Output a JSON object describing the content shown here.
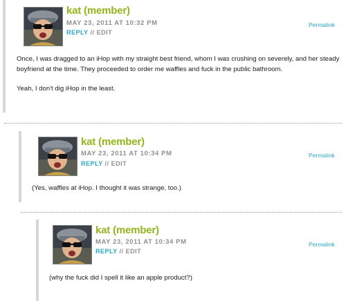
{
  "comments": [
    {
      "author": "kat (member)",
      "date": "MAY 23, 2011 AT 10:32 PM",
      "reply_label": "REPLY",
      "separator": "//",
      "edit_label": "EDIT",
      "permalink": "Permalink",
      "paragraphs": [
        "Once, I was dragged to an iHop with my straight best friend, whom I was crushing on severely, and her steady boyfriend at the time. They proceeded to order me waffles and fuck in the public bathroom.",
        "Yeah, I don't dig iHop in the least."
      ]
    },
    {
      "author": "kat (member)",
      "date": "MAY 23, 2011 AT 10:34 PM",
      "reply_label": "REPLY",
      "separator": "//",
      "edit_label": "EDIT",
      "permalink": "Permalink",
      "paragraphs": [
        "(Yes, waffles at iHop. I thought it was strange, too.)"
      ]
    },
    {
      "author": "kat (member)",
      "date": "MAY 23, 2011 AT 10:34 PM",
      "reply_label": "REPLY",
      "separator": "//",
      "edit_label": "EDIT",
      "permalink": "Permalink",
      "paragraphs": [
        "(why the fuck did I spell it like an apple product?)"
      ]
    }
  ]
}
